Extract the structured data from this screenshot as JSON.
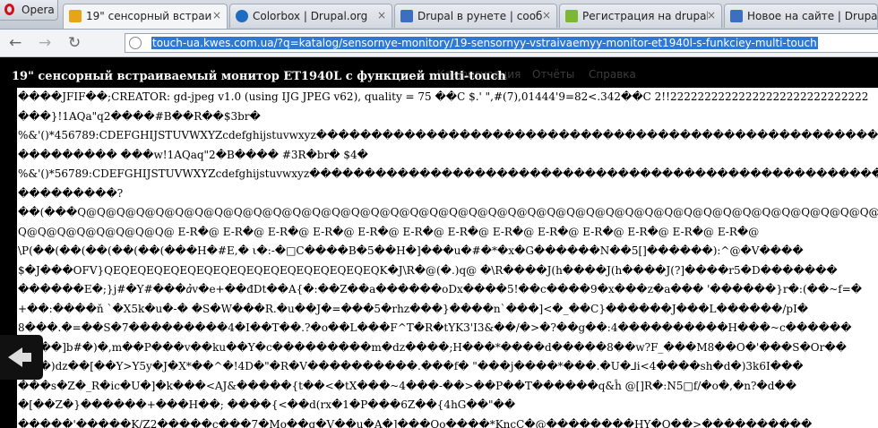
{
  "browser": {
    "menu_label": "Opera",
    "tabs": [
      {
        "label": "19\" сенсорный встраив",
        "icon": "page-icon",
        "color": "#e8a317",
        "active": true
      },
      {
        "label": "Colorbox | Drupal.org",
        "icon": "drupal-icon",
        "color": "#1f6dc2"
      },
      {
        "label": "Drupal в рунете | сообщ",
        "icon": "drupal-ru-icon",
        "color": "#3b6fbf"
      },
      {
        "label": "Регистрация на drupal.r",
        "icon": "form-icon",
        "color": "#7db831"
      },
      {
        "label": "Новое на сайте | Drupal",
        "icon": "drupal-ru-icon",
        "color": "#3b6fbf"
      }
    ],
    "close_glyph": "×",
    "url": "touch-ua.kwes.com.ua/?q=katalog/sensornye-monitory/19-sensornyy-vstraivaemyy-monitor-et1940l-s-funkciey-multi-touch",
    "nav": {
      "back": "←",
      "forward": "→",
      "reload": "↻"
    }
  },
  "page": {
    "ghost_nav": [
      "Конфигурация",
      "Отчёты",
      "Справка"
    ],
    "title": "19\" сенсорный встраиваемый монитор ET1940L с функцией multi-touch",
    "lines": [
      "����JFIF��;CREATOR: gd-jpeg v1.0 (using IJG JPEG v62), quality = 75 ��C   $.' \",#(7),01444'9=82<.342��C  2!!22222222222222222222222222222",
      "���}!1AQa\"q2����#B��R��$3br�",
      "%&'()*456789:CDEFGHIJSTUVWXYZcdefghijstuvwxyz����������������������������������������������������������",
      "��������� ���w!1AQaq\"2�B����  #3R�br�  $4�",
      "%&'()*56789:CDEFGHIJSTUVWXYZcdefghijstuvwxyz����������������������������������������������������������",
      "���������?",
      "��(���Q@Q@Q@Q@Q@Q@Q@Q@Q@Q@Q@Q@Q@Q@Q@Q@Q@Q@Q@Q@Q@Q@Q@Q@Q@Q@Q@Q@Q@Q@Q@Q@Q@Q@Q@Q@Q@Q@Q@Q@Q@Q@Q@",
      "Q@Q@Q@Q@Q@Q@Q@Q@ E-R�@ E-R�@ E-R�@ E-R�@ E-R�@ E-R�@ E-R�@ E-R�@ E-R�@ E-R�@ E-R�@ E-R�@ E-R�@",
      "\\P(��(��(��(��(��(���H�#E,� ι�:-�□C����B�5��H�]���u�#�*�x�G������N��5[]������):^@�V����",
      "$�J���OFV}QEQEQEQEQEQEQEQEQEQEQEQEQEQEQEQEQK�J\\R�@(�.)q@ �\\R����J(h����J(h����J(?]����r5�D�������",
      "������E�;}j#�Y#���ꞻv�e+��đDt��A{�:��Z��a������oDx����5!��c����9�x���z�a���  '������}r�:(��~f=�",
      "+��:����ň  `�X5k�u�-� �S�W���R.�u��J�=���5�rhz���}����n`���]<�_��C}������J���L������/pI�",
      "8���.�=��S�7���������4�I��T��.?�o��L���F^T�R�tYK3'I3&��/�>�?��g��:4����������H���~c������",
      "����]b#�)�,m��P���v��ku��Y�c���������m�dz����;H���*����d�����8��w?F_���M8��O�'���S�Or��",
      "���)dz��[��Y>Y5y�J�X*��^�!4D�\"�R�V����������.���f�  \"���j����*���.�U�⅃i<4����sh�d�)3k6I���",
      "���s�Z�_R�ic�U�]�k���<AJ&�����{t��<�tX���~4���-��>��P��T������q&ĥ  @[]R�:N5□f/�o�,�n?�d��",
      "�[��Z�}������+���H��; ����{<��d(rx�1�P���6Z��{4hG��\"��",
      "�����'�����K/Z2�����c���7�Mo��g�V��u�A�]���Oo����*KncC�@��������HY�O��>����������"
    ]
  }
}
